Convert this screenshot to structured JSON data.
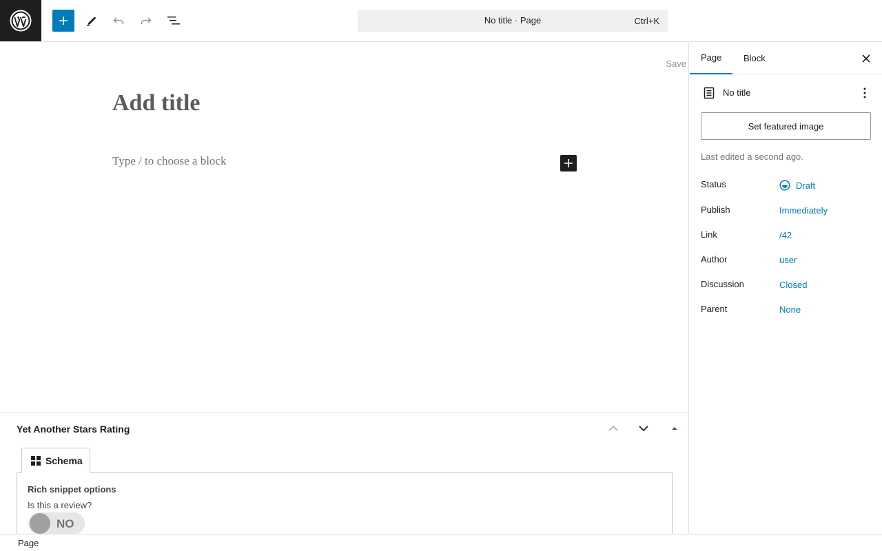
{
  "toolbar": {
    "logo": "wordpress-logo",
    "inserter_icon": "plus-icon",
    "tools_icon": "pencil-icon",
    "undo_icon": "undo-icon",
    "redo_icon": "redo-icon",
    "list_view_icon": "list-view-icon",
    "command_bar": {
      "title": "No title · Page",
      "shortcut": "Ctrl+K"
    },
    "accent_color": "#007cba"
  },
  "editor": {
    "save_label": "Save",
    "title_placeholder": "Add title",
    "block_placeholder": "Type / to choose a block"
  },
  "metabox": {
    "title": "Yet Another Stars Rating",
    "tab_label": "Schema",
    "rich_snippet_label": "Rich snippet options",
    "review_question": "Is this a review?",
    "toggle_label": "NO"
  },
  "sidebar": {
    "tabs": [
      {
        "label": "Page",
        "active": true
      },
      {
        "label": "Block",
        "active": false
      }
    ],
    "post_title": "No title",
    "featured_image_label": "Set featured image",
    "last_edited": "Last edited a second ago.",
    "meta": [
      {
        "label": "Status",
        "value": "Draft"
      },
      {
        "label": "Publish",
        "value": "Immediately"
      },
      {
        "label": "Link",
        "value": "/42"
      },
      {
        "label": "Author",
        "value": "user"
      },
      {
        "label": "Discussion",
        "value": "Closed"
      },
      {
        "label": "Parent",
        "value": "None"
      }
    ]
  },
  "footer": {
    "breadcrumb": "Page"
  }
}
